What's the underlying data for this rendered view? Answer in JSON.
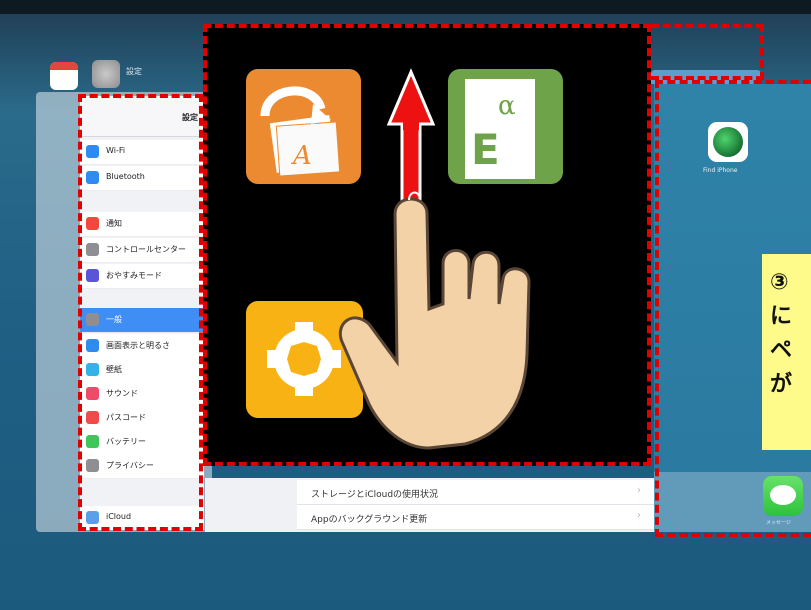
{
  "header": {
    "settings_app_label": "設定"
  },
  "settings": {
    "title": "設定",
    "items": [
      {
        "label": "Wi-Fi",
        "icon": "wifi-icon",
        "color": "#2f8bf0"
      },
      {
        "label": "Bluetooth",
        "icon": "bluetooth-icon",
        "color": "#2f8bf0"
      },
      {
        "label": "通知",
        "icon": "notification-icon",
        "color": "#f04a3e"
      },
      {
        "label": "コントロールセンター",
        "icon": "control-center-icon",
        "color": "#8e8e93"
      },
      {
        "label": "おやすみモード",
        "icon": "moon-icon",
        "color": "#5a55d6"
      },
      {
        "label": "一般",
        "icon": "gear-icon",
        "color": "#8e8e93"
      },
      {
        "label": "画面表示と明るさ",
        "icon": "display-icon",
        "color": "#2f8bf0"
      },
      {
        "label": "壁紙",
        "icon": "wallpaper-icon",
        "color": "#32b2e8"
      },
      {
        "label": "サウンド",
        "icon": "sound-icon",
        "color": "#f04a6a"
      },
      {
        "label": "パスコード",
        "icon": "lock-icon",
        "color": "#f04a4a"
      },
      {
        "label": "バッテリー",
        "icon": "battery-icon",
        "color": "#3fc65a"
      },
      {
        "label": "プライバシー",
        "icon": "hand-icon",
        "color": "#8e8e93"
      },
      {
        "label": "iCloud",
        "icon": "cloud-icon",
        "color": "#5a9fe8"
      }
    ],
    "selected_index": 5
  },
  "detail": {
    "rows": [
      "ストレージとiCloudの使用状況",
      "Appのバックグラウンド更新"
    ]
  },
  "right_card": {
    "find_iphone_label": "Find iPhone",
    "messages_label": "メッセージ"
  },
  "callout": {
    "lines": [
      "③",
      "に",
      "ペ",
      "が"
    ]
  },
  "colors": {
    "annotation_red": "#e00000",
    "callout_yellow": "#fffb8a",
    "arrow_red": "#ee1111"
  }
}
